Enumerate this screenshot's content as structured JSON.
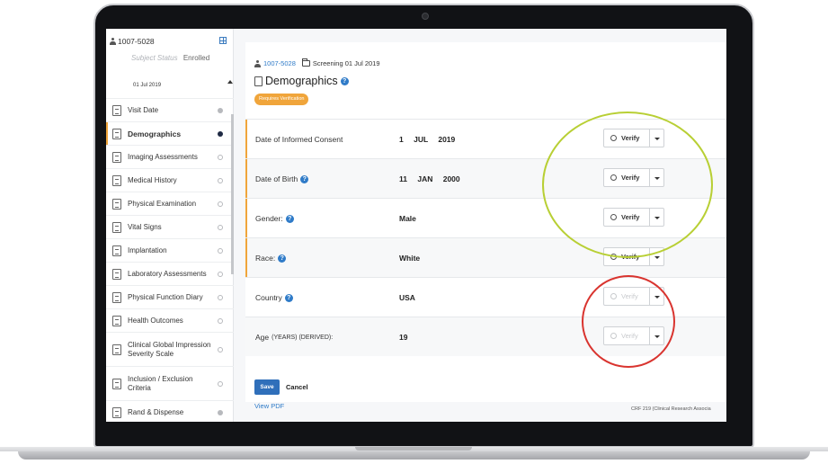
{
  "subject": {
    "id": "1007-5028",
    "status_label": "Subject Status",
    "status_value": "Enrolled"
  },
  "sidebar": {
    "visit_date": "01 Jul 2019",
    "items": [
      {
        "label": "Visit Date",
        "state": "filled-grey"
      },
      {
        "label": "Demographics",
        "state": "filled-dark"
      },
      {
        "label": "Imaging Assessments",
        "state": "empty"
      },
      {
        "label": "Medical History",
        "state": "empty"
      },
      {
        "label": "Physical Examination",
        "state": "empty"
      },
      {
        "label": "Vital Signs",
        "state": "empty"
      },
      {
        "label": "Implantation",
        "state": "empty"
      },
      {
        "label": "Laboratory Assessments",
        "state": "empty"
      },
      {
        "label": "Physical Function Diary",
        "state": "empty"
      },
      {
        "label": "Health Outcomes",
        "state": "empty"
      },
      {
        "label": "Clinical Global Impression Severity Scale",
        "state": "empty"
      },
      {
        "label": "Inclusion / Exclusion Criteria",
        "state": "empty"
      },
      {
        "label": "Rand & Dispense",
        "state": "filled-grey"
      }
    ]
  },
  "header": {
    "subject_link": "1007-5028",
    "visit": "Screening 01 Jul 2019",
    "title": "Demographics",
    "badge": "Requires Verification"
  },
  "fields": [
    {
      "label": "Date of Informed Consent",
      "help": false,
      "value": "1 JUL 2019",
      "verify": "Verify",
      "enabled": true
    },
    {
      "label": "Date of Birth",
      "help": true,
      "value": "11 JAN 2000",
      "verify": "Verify",
      "enabled": true
    },
    {
      "label": "Gender:",
      "help": true,
      "value": "Male",
      "verify": "Verify",
      "enabled": true
    },
    {
      "label": "Race:",
      "help": true,
      "value": "White",
      "verify": "Verify",
      "enabled": true
    },
    {
      "label": "Country",
      "help": true,
      "value": "USA",
      "verify": "Verify",
      "enabled": false
    },
    {
      "label": "Age",
      "unit": "(YEARS) (DERIVED):",
      "help": false,
      "value": "19",
      "verify": "Verify",
      "enabled": false
    }
  ],
  "actions": {
    "save": "Save",
    "cancel": "Cancel"
  },
  "footer": {
    "view_pdf": "View PDF",
    "crf": "CRF 219     (Clinical Research Associa"
  },
  "colors": {
    "accent_orange": "#f0a53b",
    "link_blue": "#2f7bc8",
    "annotation_green": "#b8cf34",
    "annotation_red": "#d9342f"
  }
}
